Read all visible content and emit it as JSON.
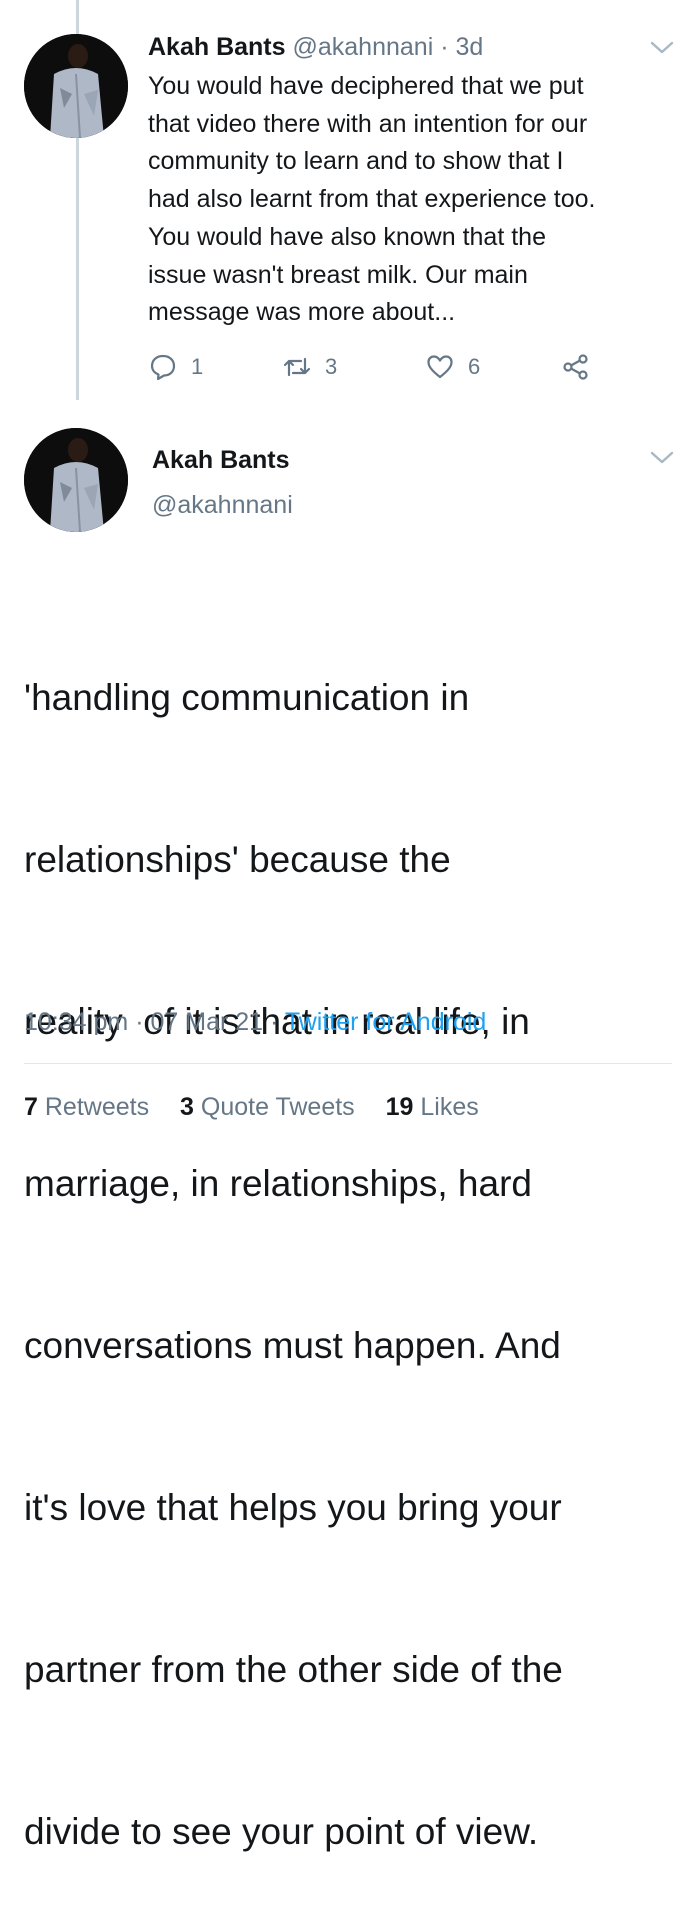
{
  "reply_tweet": {
    "author_name": "Akah Bants",
    "handle": "@akahnnani",
    "separator": "·",
    "age": "3d",
    "text_lines": [
      "You would have deciphered that we put",
      "that video there with an intention for our",
      "community to learn and to show that I",
      "had also learnt from that experience too.",
      "You would have also known that the",
      "issue wasn't breast milk. Our main",
      "message was more about..."
    ],
    "replies": "1",
    "retweets": "3",
    "likes": "6",
    "icons": [
      "reply-icon",
      "retweet-icon",
      "like-icon",
      "share-icon",
      "chevron-down-icon"
    ]
  },
  "main_tweet": {
    "author_name": "Akah Bants",
    "handle": "@akahnnani",
    "text_lines": [
      "'handling communication in",
      "relationships' because the",
      "reality  of it is that in real life, in",
      "marriage, in relationships, hard",
      "conversations must happen. And",
      "it's love that helps you bring your",
      "partner from the other side of the",
      "divide to see your point of view."
    ],
    "time": "10:34 pm",
    "date": "07 Mar 21",
    "separator": "·",
    "source": "Twitter for Android",
    "retweet_count": "7",
    "retweet_label": "Retweets",
    "quote_count": "3",
    "quote_label": "Quote Tweets",
    "like_count": "19",
    "like_label": "Likes"
  },
  "colors": {
    "text": "#14171a",
    "secondary": "#657786",
    "link": "#1da1f2",
    "thread_line": "#ccd6dd"
  }
}
